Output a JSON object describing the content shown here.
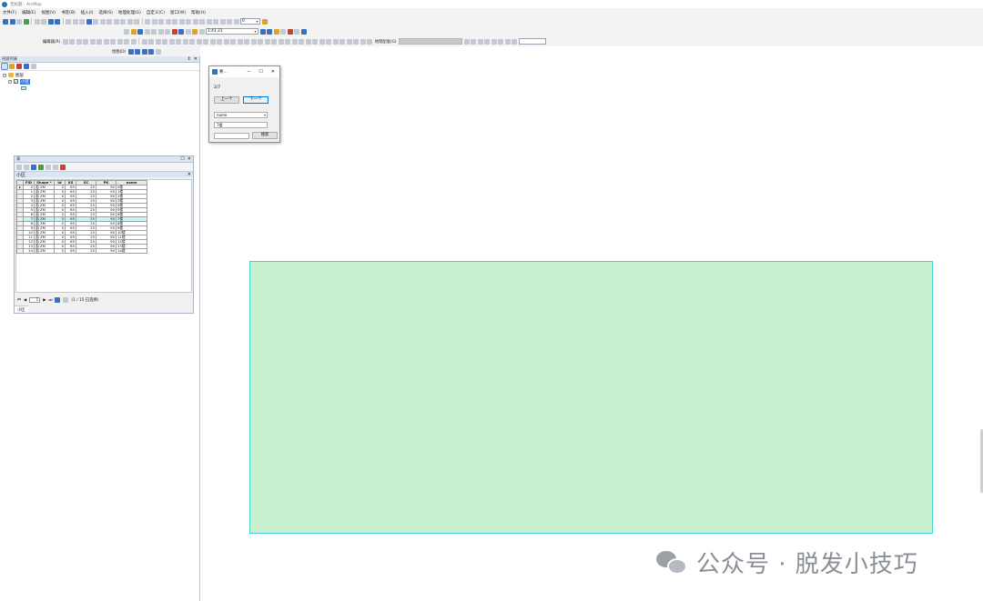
{
  "window": {
    "title": "无标题 - ArcMap"
  },
  "menu": [
    "文件(F)",
    "编辑(E)",
    "视图(V)",
    "书签(B)",
    "插入(I)",
    "选择(S)",
    "地理处理(G)",
    "自定义(C)",
    "窗口(W)",
    "帮助(H)"
  ],
  "toolbar": {
    "scale_value": "1:41 21",
    "layer_combo": "0",
    "edit_label": "编辑器(R)",
    "georef_label": "地理配准(G)",
    "draw_label": "绘图(D)"
  },
  "toc": {
    "title": "内容列表",
    "group_name": "图层",
    "layer_name": "小区"
  },
  "attribute_table": {
    "window_title": "表",
    "tab_title": "小区",
    "columns": [
      "FID",
      "Shape *",
      "Id",
      "XS",
      "SC",
      "PK",
      "name"
    ],
    "rows": [
      [
        "0",
        "面 ZM",
        "0",
        "65",
        "25",
        "90",
        "0楼"
      ],
      [
        "1",
        "面 ZM",
        "0",
        "65",
        "25",
        "90",
        "1楼"
      ],
      [
        "2",
        "面 ZM",
        "0",
        "65",
        "25",
        "90",
        "2楼"
      ],
      [
        "3",
        "面 ZM",
        "0",
        "65",
        "25",
        "90",
        "3楼"
      ],
      [
        "4",
        "面 ZM",
        "0",
        "65",
        "25",
        "90",
        "4楼"
      ],
      [
        "5",
        "面 ZM",
        "0",
        "65",
        "25",
        "90",
        "5楼"
      ],
      [
        "6",
        "面 ZM",
        "0",
        "65",
        "25",
        "90",
        "6楼"
      ],
      [
        "7",
        "面 ZM",
        "0",
        "65",
        "25",
        "90",
        "7楼"
      ],
      [
        "8",
        "面 ZM",
        "0",
        "65",
        "25",
        "90",
        "8楼"
      ],
      [
        "9",
        "面 ZM",
        "0",
        "65",
        "25",
        "90",
        "9楼"
      ],
      [
        "10",
        "面 ZM",
        "0",
        "65",
        "25",
        "90",
        "10楼"
      ],
      [
        "11",
        "面 ZM",
        "0",
        "65",
        "25",
        "90",
        "11楼"
      ],
      [
        "12",
        "面 ZM",
        "0",
        "65",
        "25",
        "90",
        "12楼"
      ],
      [
        "13",
        "面 ZM",
        "0",
        "65",
        "25",
        "90",
        "13楼"
      ],
      [
        "14",
        "面 ZM",
        "0",
        "65",
        "25",
        "90",
        "14楼"
      ]
    ],
    "highlight_row": 7,
    "current_row": 0,
    "record_value": "1",
    "status": "(1 / 15 已选择)",
    "bottom_tab": "小区"
  },
  "dialog": {
    "title": "要...",
    "counter": "2/7",
    "prev_label": "上一个",
    "next_label": "下一个",
    "field_select": "name",
    "value_text": "7楼",
    "search_input": "",
    "search_button": "搜索"
  },
  "map": {
    "polygon_fill": "#c8f0d0",
    "polygon_stroke": "#47d1d3"
  },
  "watermark": {
    "text": "公众号 · 脱发小技巧"
  }
}
